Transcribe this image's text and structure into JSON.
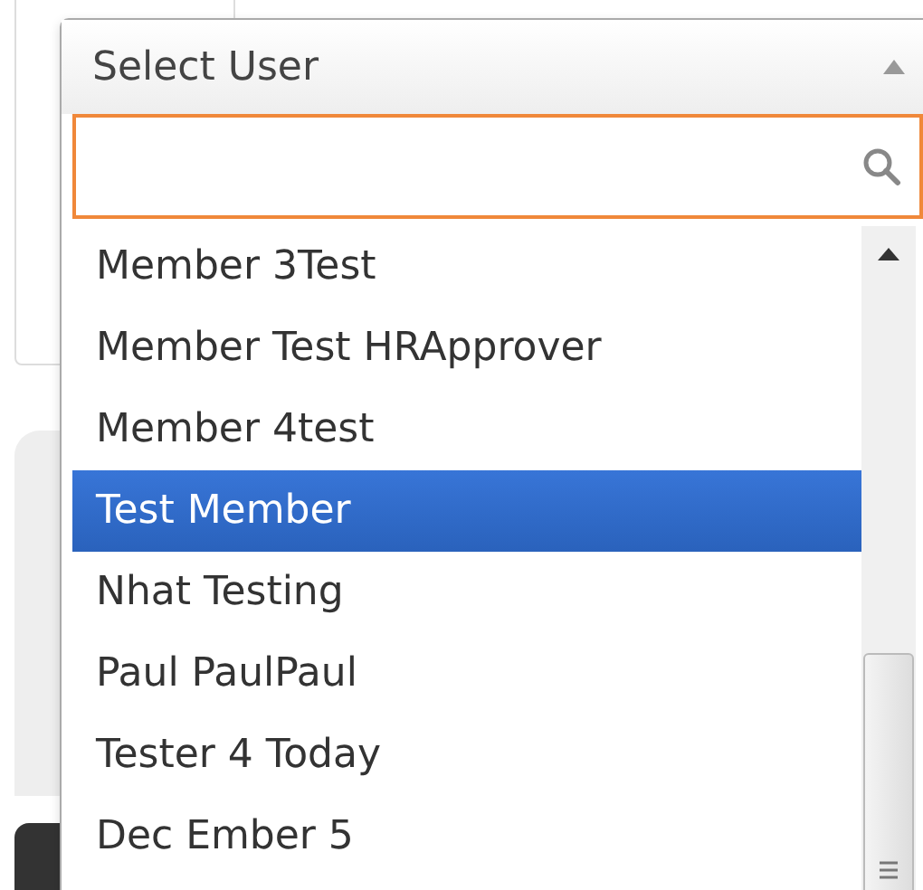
{
  "select": {
    "label": "Select User",
    "options": [
      {
        "label": "Member 3Test",
        "selected": false
      },
      {
        "label": "Member Test HRApprover",
        "selected": false
      },
      {
        "label": "Member 4test",
        "selected": false
      },
      {
        "label": "Test Member",
        "selected": true
      },
      {
        "label": "Nhat Testing",
        "selected": false
      },
      {
        "label": "Paul PaulPaul",
        "selected": false
      },
      {
        "label": "Tester 4 Today",
        "selected": false
      },
      {
        "label": "Dec Ember 5",
        "selected": false
      }
    ]
  }
}
